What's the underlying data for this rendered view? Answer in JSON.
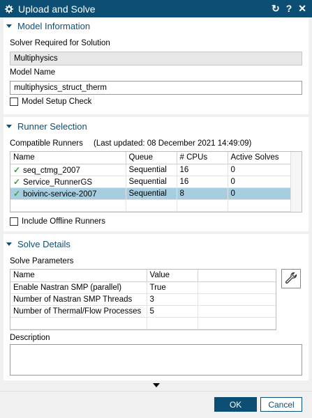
{
  "window": {
    "title": "Upload and Solve",
    "controls": {
      "refresh": "↻",
      "help": "?",
      "close": "✕"
    }
  },
  "model_info": {
    "header": "Model Information",
    "solver_label": "Solver Required for Solution",
    "solver_value": "Multiphysics",
    "model_name_label": "Model Name",
    "model_name_value": "multiphysics_struct_therm",
    "setup_check_label": "Model Setup Check"
  },
  "runner_selection": {
    "header": "Runner Selection",
    "compatible_label": "Compatible Runners",
    "last_updated": "(Last updated: 08 December 2021 14:49:09)",
    "columns": [
      "Name",
      "Queue",
      "# CPUs",
      "Active Solves"
    ],
    "rows": [
      {
        "name": "seq_ctmg_2007",
        "queue": "Sequential",
        "cpus": "16",
        "active": "0",
        "selected": false
      },
      {
        "name": "Service_RunnerGS",
        "queue": "Sequential",
        "cpus": "16",
        "active": "0",
        "selected": false
      },
      {
        "name": "boivinc-service-2007",
        "queue": "Sequential",
        "cpus": "8",
        "active": "0",
        "selected": true
      }
    ],
    "offline_label": "Include Offline Runners"
  },
  "solve_details": {
    "header": "Solve Details",
    "params_label": "Solve Parameters",
    "columns": [
      "Name",
      "Value"
    ],
    "rows": [
      {
        "name": "Enable Nastran SMP (parallel)",
        "value": "True"
      },
      {
        "name": "Number of Nastran SMP Threads",
        "value": "3"
      },
      {
        "name": "Number of Thermal/Flow Processes",
        "value": "5"
      }
    ],
    "description_label": "Description"
  },
  "footer": {
    "ok_label": "OK",
    "cancel_label": "Cancel"
  },
  "colors": {
    "accent": "#0d4f74",
    "selected_row": "#a6cee0",
    "check": "#3ca331"
  },
  "icons": [
    "gear-icon",
    "refresh-icon",
    "help-icon",
    "close-icon",
    "collapse-caret-icon",
    "check-icon",
    "wrench-icon",
    "expand-arrow-icon"
  ]
}
